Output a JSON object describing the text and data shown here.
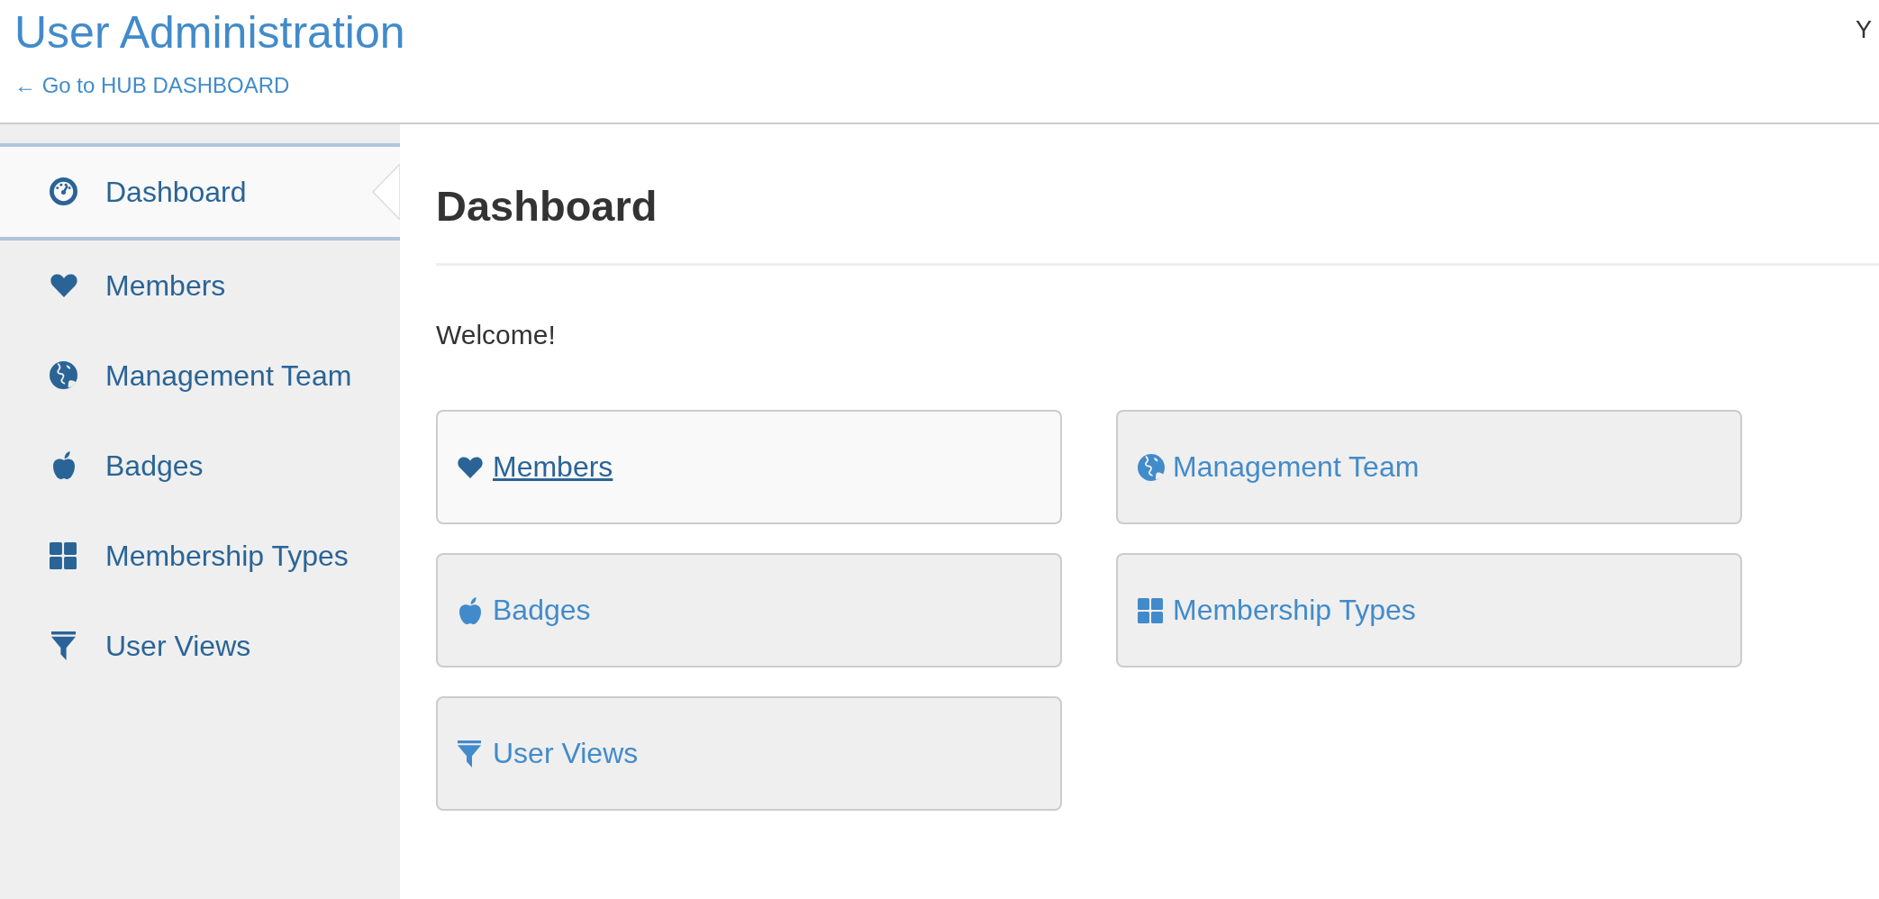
{
  "header": {
    "title": "User Administration",
    "back_link": "← Go to HUB DASHBOARD",
    "right_text": "Y"
  },
  "sidebar": {
    "items": [
      {
        "label": "Dashboard",
        "selected": true
      },
      {
        "label": "Members",
        "selected": false
      },
      {
        "label": "Management Team",
        "selected": false
      },
      {
        "label": "Badges",
        "selected": false
      },
      {
        "label": "Membership Types",
        "selected": false
      },
      {
        "label": "User Views",
        "selected": false
      }
    ]
  },
  "main": {
    "heading": "Dashboard",
    "welcome": "Welcome!",
    "tiles": [
      {
        "label": "Members",
        "hovered": true
      },
      {
        "label": "Management Team",
        "hovered": false
      },
      {
        "label": "Badges",
        "hovered": false
      },
      {
        "label": "Membership Types",
        "hovered": false
      },
      {
        "label": "User Views",
        "hovered": false
      }
    ]
  }
}
